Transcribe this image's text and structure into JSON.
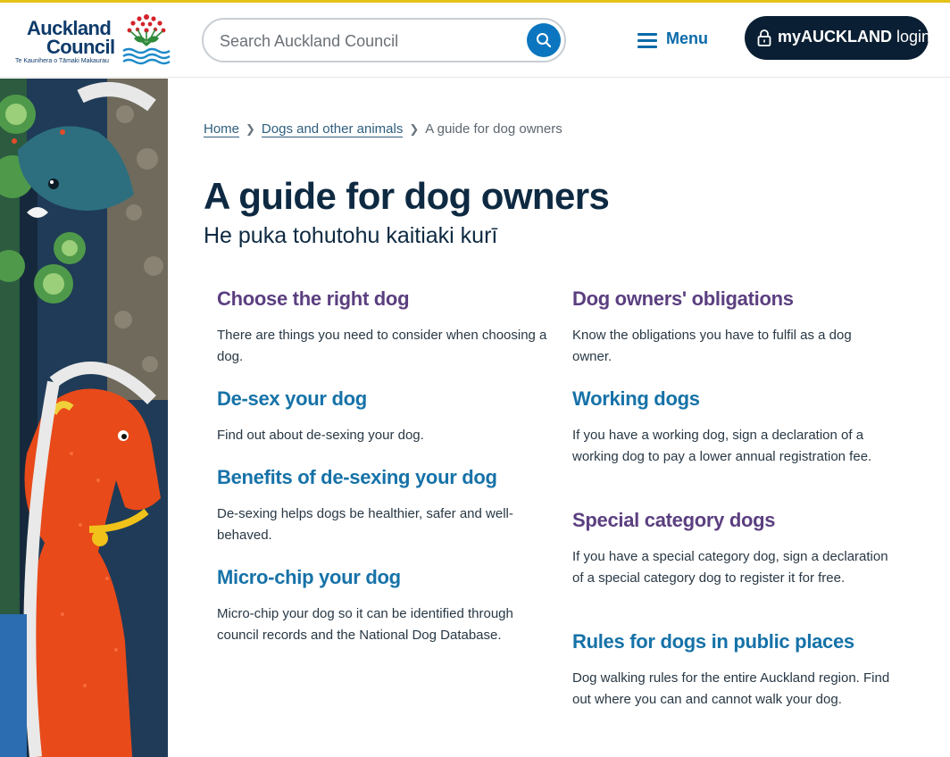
{
  "header": {
    "logo_line1": "Auckland",
    "logo_line2": "Council",
    "logo_tagline": "Te Kaunihera o Tāmaki Makaurau",
    "search_placeholder": "Search Auckland Council",
    "menu_label": "Menu",
    "login_brand": "myAUCKLAND",
    "login_suffix": " login",
    "login_prefix": "my"
  },
  "breadcrumb": {
    "items": [
      "Home",
      "Dogs and other animals"
    ],
    "current": "A guide for dog owners"
  },
  "page": {
    "title": "A guide for dog owners",
    "subtitle": "He puka tohutohu kaitiaki kurī"
  },
  "cards": [
    {
      "title": "Choose the right dog",
      "desc": "There are things you need to consider when choosing a dog.",
      "color": "#5b3f80"
    },
    {
      "title": "De-sex your dog",
      "desc": "Find out about de-sexing your dog.",
      "color": "#1672a8"
    },
    {
      "title": "Benefits of de-sexing your dog",
      "desc": "De-sexing helps dogs be healthier, safer and well-behaved.",
      "color": "#1672a8"
    },
    {
      "title": "Micro-chip your dog",
      "desc": "Micro-chip your dog so it can be identified through council records and the National Dog Database.",
      "color": "#1672a8"
    },
    {
      "title": "Dog owners' obligations",
      "desc": "Know the obligations you have to fulfil as a dog owner.",
      "color": "#5b3f80"
    },
    {
      "title": "Working dogs",
      "desc": "If you have a working dog, sign a declaration of a working dog to pay a lower annual registration fee.",
      "color": "#1672a8"
    },
    {
      "title": "Special category dogs",
      "desc": "If you have a special category dog, sign a declaration of a special category dog to register it for free.",
      "color": "#5b3f80"
    },
    {
      "title": "Rules for dogs in public places",
      "desc": "Dog walking rules for the entire Auckland region. Find out where you can and cannot walk your dog.",
      "color": "#1672a8"
    }
  ],
  "icons": {
    "search": "search-icon",
    "menu": "hamburger-icon",
    "login": "lock-icon",
    "breadcrumb_separator": "chevron-right-icon"
  },
  "colors": {
    "accent_yellow": "#e5c21a",
    "navy": "#0a1f33",
    "link_blue": "#1672a8",
    "link_purple": "#5b3f80"
  }
}
